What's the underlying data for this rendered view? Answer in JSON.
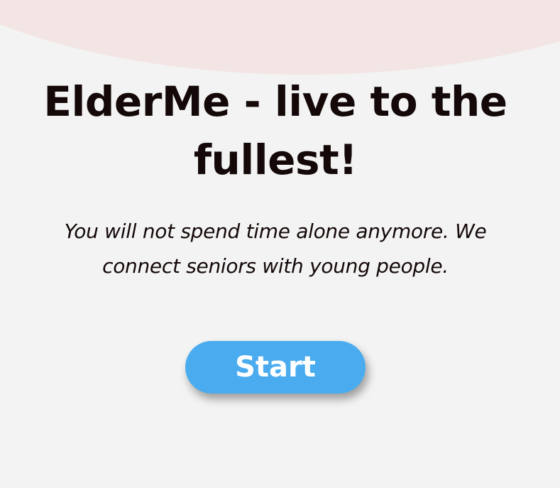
{
  "hero": {
    "title": "ElderMe - live to the fullest!",
    "subtitle": "You will not spend time alone anymore. We connect seniors with young people.",
    "start_label": "Start"
  },
  "colors": {
    "background": "#f3f3f3",
    "blob": "#f3e5e4",
    "text": "#140808",
    "button": "#4aacef",
    "button_text": "#ffffff"
  }
}
